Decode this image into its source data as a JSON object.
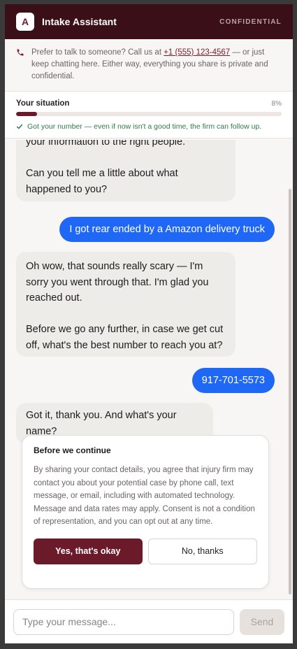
{
  "header": {
    "logo_letter": "A",
    "title": "Intake Assistant",
    "badge": "CONFIDENTIAL"
  },
  "notice": {
    "text_before": "Prefer to talk to someone? Call us at ",
    "phone": "+1 (555) 123-4567",
    "text_after": " — or just keep chatting here. Either way, everything you share is private and confidential.",
    "icon": "phone-icon"
  },
  "progress": {
    "label": "Your situation",
    "percent_text": "8%",
    "percent_value": 8,
    "note": "Got your number — even if now isn't a good time, the firm can follow up."
  },
  "messages": {
    "m1": "your information to the right people.\n\nCan you tell me a little about what happened to you?",
    "m2": "I got rear ended by a Amazon delivery truck",
    "m3": "Oh wow, that sounds really scary — I'm sorry you went through that. I'm glad you reached out.\n\nBefore we go any further, in case we get cut off, what's the best number to reach you at?",
    "m4": "917-701-5573",
    "m5": "Got it, thank you. And what's your name?"
  },
  "consent": {
    "title": "Before we continue",
    "body": "By sharing your contact details, you agree that injury firm may contact you about your potential case by phone call, text message, or email, including with automated technology. Message and data rates may apply. Consent is not a condition of representation, and you can opt out at any time.",
    "yes_label": "Yes, that's okay",
    "no_label": "No, thanks"
  },
  "composer": {
    "placeholder": "Type your message...",
    "send_label": "Send"
  },
  "colors": {
    "header_bg": "#3b0f18",
    "accent": "#6b1a2a",
    "user_bubble": "#1f67f5",
    "success": "#2f7a4a"
  }
}
